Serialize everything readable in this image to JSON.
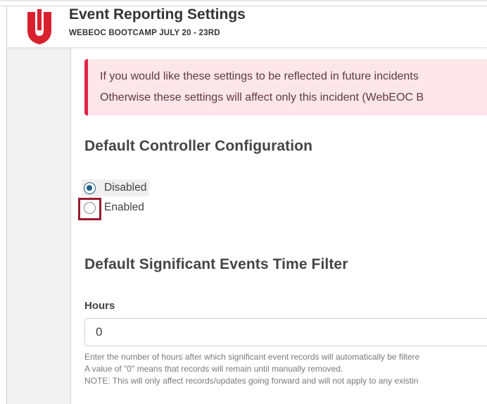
{
  "header": {
    "title": "Event Reporting Settings",
    "subtitle": "WEBEOC BOOTCAMP JULY 20 - 23RD",
    "logo_icon": "juvare-shield-icon",
    "logo_color": "#d9202f"
  },
  "alert": {
    "line1": "If you would like these settings to be reflected in future incidents",
    "line2": "Otherwise these settings will affect only this incident (WebEOC B",
    "accent": "#e02449"
  },
  "controller": {
    "title": "Default Controller Configuration",
    "options": [
      {
        "label": "Disabled",
        "checked": true
      },
      {
        "label": "Enabled",
        "checked": false
      }
    ]
  },
  "time_filter": {
    "title": "Default Significant Events Time Filter",
    "hours_label": "Hours",
    "hours_value": "0",
    "help_lines": [
      "Enter the number of hours after which significant event records will automatically be filtere",
      "A value of \"0\" means that records will remain until manually removed.",
      "NOTE: This will only affect records/updates going forward and will not apply to any existin"
    ]
  }
}
